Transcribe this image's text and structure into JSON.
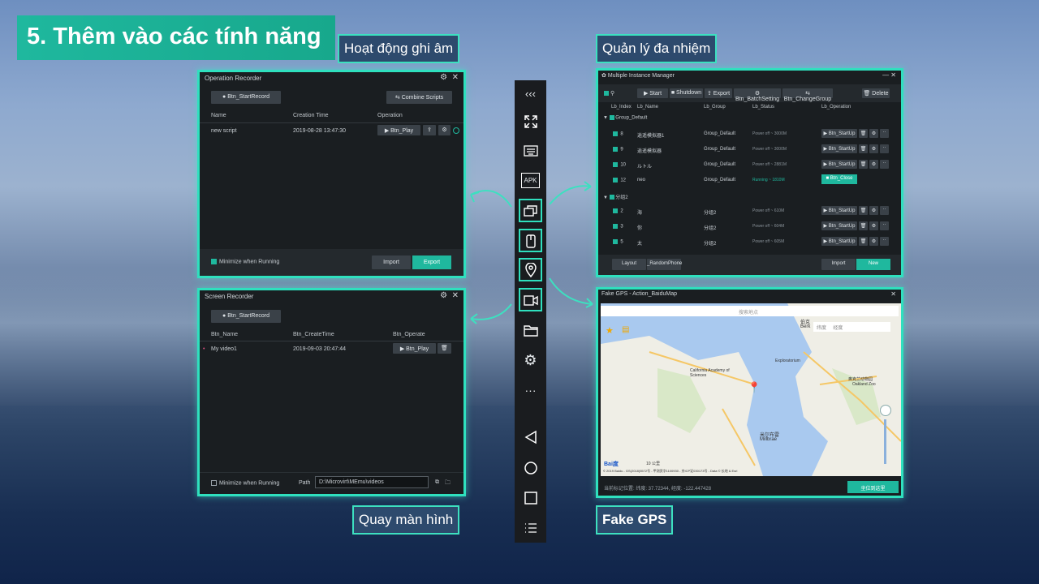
{
  "title": "5. Thêm vào các tính năng",
  "labels": {
    "rec": "Hoạt động ghi âm",
    "multi": "Quản lý đa nhiệm",
    "screen": "Quay màn hình",
    "gps": "Fake GPS"
  },
  "op": {
    "title": "Operation Recorder",
    "start": "Btn_StartRecord",
    "combine": "Combine Scripts",
    "cols": [
      "Name",
      "Creation Time",
      "Operation"
    ],
    "row": {
      "name": "new script",
      "time": "2019-08-28 13:47:30",
      "play": "Btn_Play"
    },
    "minimize": "Minimize when Running",
    "import": "Import",
    "export": "Export"
  },
  "sr": {
    "title": "Screen Recorder",
    "start": "Btn_StartRecord",
    "cols": [
      "Btn_Name",
      "Btn_CreateTime",
      "Btn_Operate"
    ],
    "row": {
      "name": "My video1",
      "time": "2019-09-03 20:47:44",
      "play": "Btn_Play"
    },
    "minimize": "Minimize when Running",
    "path_label": "Path",
    "path": "D:\\Microvirt\\MEmu\\videos"
  },
  "mim": {
    "title": "Multiple Instance Manager",
    "toolbar": [
      "Start",
      "Shutdown",
      "Export",
      "Btn_BatchSetting",
      "Btn_ChangeGroup"
    ],
    "delete": "Delete",
    "cols": [
      "Lb_Index",
      "Lb_Name",
      "Lb_Group",
      "Lb_Status",
      "Lb_Operation"
    ],
    "groups": [
      {
        "name": "Group_Default",
        "rows": [
          {
            "i": "8",
            "n": "逍遥模拟器1",
            "g": "Group_Default",
            "s": "Power off ~ 3000M",
            "op": "Btn_StartUp"
          },
          {
            "i": "9",
            "n": "逍遥模拟器",
            "g": "Group_Default",
            "s": "Power off ~ 3000M",
            "op": "Btn_StartUp"
          },
          {
            "i": "10",
            "n": "ルトル",
            "g": "Group_Default",
            "s": "Power off ~ 2881M",
            "op": "Btn_StartUp"
          },
          {
            "i": "12",
            "n": "neo",
            "g": "Group_Default",
            "s": "Running ~ 1810M",
            "op": "Btn_Close"
          }
        ]
      },
      {
        "name": "分组2",
        "rows": [
          {
            "i": "2",
            "n": "海",
            "g": "分组2",
            "s": "Power off ~ 610M",
            "op": "Btn_StartUp"
          },
          {
            "i": "3",
            "n": "你",
            "g": "分组2",
            "s": "Power off ~ 604M",
            "op": "Btn_StartUp"
          },
          {
            "i": "5",
            "n": "太",
            "g": "分组2",
            "s": "Power off ~ 605M",
            "op": "Btn_StartUp"
          }
        ]
      }
    ],
    "layout": "Layout",
    "random": "_RandomPhone",
    "import": "Import",
    "new": "New"
  },
  "gps": {
    "title": "Fake GPS - Action_BaiduMap",
    "search": "搜索地点",
    "status": "当前标记位置: 纬度: 37.72344, 经度: -122.447428",
    "confirm": "坐位到这里",
    "map_labels": [
      "伯克",
      "Berk",
      "纬度",
      "经度",
      "奥克兰动物园",
      "Oakland Zoo",
      "米尔布雷",
      "Millbrae",
      "California Academy of Sciences",
      "Exploratorium",
      "10 公里",
      "© 2019 Baidu - GS(2018)5572号 - 甲测资字1100930 - 京ICP证030173号 - Data © 长地 & Esri"
    ]
  },
  "toolbar": [
    "back-arrows",
    "fullscreen",
    "keyboard",
    "apk",
    "multi-window",
    "recorder",
    "location",
    "video",
    "folder",
    "settings",
    "more",
    "back",
    "home",
    "recent",
    "menu"
  ]
}
